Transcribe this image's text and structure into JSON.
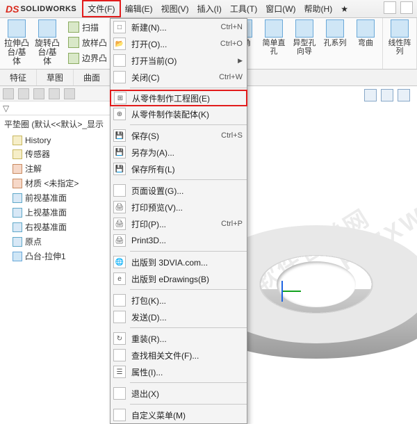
{
  "app": {
    "brand_prefix": "DS",
    "brand": "SOLIDWORKS"
  },
  "menubar": [
    "文件(F)",
    "编辑(E)",
    "视图(V)",
    "插入(I)",
    "工具(T)",
    "窗口(W)",
    "帮助(H)"
  ],
  "ribbon": {
    "groups_left": [
      {
        "label1": "拉伸凸",
        "label2": "台/基体"
      },
      {
        "label1": "旋转凸",
        "label2": "台/基体"
      }
    ],
    "left_side": [
      "扫描",
      "放样凸",
      "边界凸"
    ],
    "groups_right": [
      {
        "label": "圆角"
      },
      {
        "label": "简单直\n孔"
      },
      {
        "label": "异型孔\n向导"
      },
      {
        "label": "孔系列"
      },
      {
        "label": "弯曲"
      },
      {
        "label": "线性阵\n列"
      }
    ]
  },
  "tabs": [
    "特征",
    "草图",
    "曲面"
  ],
  "feature_tree": {
    "title": "平垫圈  (默认<<默认>_显示",
    "items": [
      "History",
      "传感器",
      "注解",
      "材质 <未指定>",
      "前视基准面",
      "上视基准面",
      "右视基准面",
      "原点",
      "凸台-拉伸1"
    ]
  },
  "dropdown": {
    "sections": [
      [
        {
          "ico": "□",
          "label": "新建(N)...",
          "shortcut": "Ctrl+N"
        },
        {
          "ico": "📂",
          "label": "打开(O)...",
          "shortcut": "Ctrl+O"
        },
        {
          "ico": "",
          "label": "打开当前(O)",
          "shortcut": "",
          "arrow": true
        },
        {
          "ico": "",
          "label": "关闭(C)",
          "shortcut": "Ctrl+W"
        }
      ],
      [
        {
          "ico": "⊞",
          "label": "从零件制作工程图(E)",
          "shortcut": "",
          "highlight": true
        },
        {
          "ico": "⊕",
          "label": "从零件制作装配体(K)",
          "shortcut": ""
        }
      ],
      [
        {
          "ico": "💾",
          "label": "保存(S)",
          "shortcut": "Ctrl+S"
        },
        {
          "ico": "💾",
          "label": "另存为(A)...",
          "shortcut": ""
        },
        {
          "ico": "💾",
          "label": "保存所有(L)",
          "shortcut": ""
        }
      ],
      [
        {
          "ico": "",
          "label": "页面设置(G)...",
          "shortcut": ""
        },
        {
          "ico": "🖨",
          "label": "打印预览(V)...",
          "shortcut": ""
        },
        {
          "ico": "🖨",
          "label": "打印(P)...",
          "shortcut": "Ctrl+P"
        },
        {
          "ico": "🖨",
          "label": "Print3D...",
          "shortcut": ""
        }
      ],
      [
        {
          "ico": "🌐",
          "label": "出版到 3DVIA.com...",
          "shortcut": ""
        },
        {
          "ico": "e",
          "label": "出版到 eDrawings(B)",
          "shortcut": ""
        }
      ],
      [
        {
          "ico": "",
          "label": "打包(K)...",
          "shortcut": ""
        },
        {
          "ico": "",
          "label": "发送(D)...",
          "shortcut": ""
        }
      ],
      [
        {
          "ico": "↻",
          "label": "重装(R)...",
          "shortcut": ""
        },
        {
          "ico": "",
          "label": "查找相关文件(F)...",
          "shortcut": ""
        },
        {
          "ico": "☰",
          "label": "属性(I)...",
          "shortcut": ""
        }
      ],
      [
        {
          "ico": "",
          "label": "退出(X)",
          "shortcut": ""
        }
      ],
      [
        {
          "ico": "",
          "label": "自定义菜单(M)",
          "shortcut": ""
        }
      ]
    ]
  },
  "watermark": "软件自学网\nWWW.RJZXW.COM"
}
